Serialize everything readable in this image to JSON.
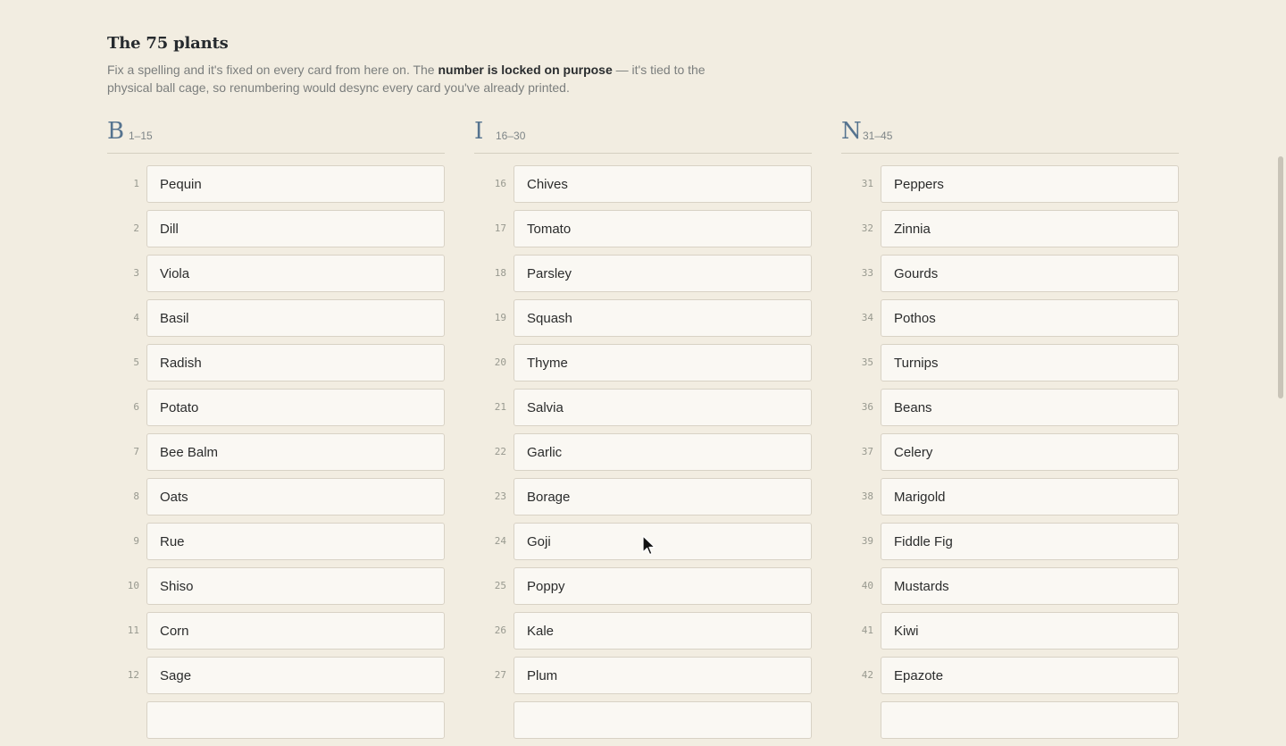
{
  "header": {
    "title": "The 75 plants",
    "desc_before": "Fix a spelling and it's fixed on every card from here on. The ",
    "desc_bold": "number is locked on purpose",
    "desc_after": " — it's tied to the physical ball cage, so renumbering would desync every card you've already printed."
  },
  "columns": [
    {
      "letter": "B",
      "range": "1–15",
      "items": [
        {
          "num": "1",
          "name": "Pequin"
        },
        {
          "num": "2",
          "name": "Dill"
        },
        {
          "num": "3",
          "name": "Viola"
        },
        {
          "num": "4",
          "name": "Basil"
        },
        {
          "num": "5",
          "name": "Radish"
        },
        {
          "num": "6",
          "name": "Potato"
        },
        {
          "num": "7",
          "name": "Bee Balm"
        },
        {
          "num": "8",
          "name": "Oats"
        },
        {
          "num": "9",
          "name": "Rue"
        },
        {
          "num": "10",
          "name": "Shiso"
        },
        {
          "num": "11",
          "name": "Corn"
        },
        {
          "num": "12",
          "name": "Sage"
        },
        {
          "num": "",
          "name": ""
        }
      ]
    },
    {
      "letter": "I",
      "range": "16–30",
      "items": [
        {
          "num": "16",
          "name": "Chives"
        },
        {
          "num": "17",
          "name": "Tomato"
        },
        {
          "num": "18",
          "name": "Parsley"
        },
        {
          "num": "19",
          "name": "Squash"
        },
        {
          "num": "20",
          "name": "Thyme"
        },
        {
          "num": "21",
          "name": "Salvia"
        },
        {
          "num": "22",
          "name": "Garlic"
        },
        {
          "num": "23",
          "name": "Borage"
        },
        {
          "num": "24",
          "name": "Goji"
        },
        {
          "num": "25",
          "name": "Poppy"
        },
        {
          "num": "26",
          "name": "Kale"
        },
        {
          "num": "27",
          "name": "Plum"
        },
        {
          "num": "",
          "name": ""
        }
      ]
    },
    {
      "letter": "N",
      "range": "31–45",
      "items": [
        {
          "num": "31",
          "name": "Peppers"
        },
        {
          "num": "32",
          "name": "Zinnia"
        },
        {
          "num": "33",
          "name": "Gourds"
        },
        {
          "num": "34",
          "name": "Pothos"
        },
        {
          "num": "35",
          "name": "Turnips"
        },
        {
          "num": "36",
          "name": "Beans"
        },
        {
          "num": "37",
          "name": "Celery"
        },
        {
          "num": "38",
          "name": "Marigold"
        },
        {
          "num": "39",
          "name": "Fiddle Fig"
        },
        {
          "num": "40",
          "name": "Mustards"
        },
        {
          "num": "41",
          "name": "Kiwi"
        },
        {
          "num": "42",
          "name": "Epazote"
        },
        {
          "num": "",
          "name": ""
        }
      ]
    }
  ]
}
